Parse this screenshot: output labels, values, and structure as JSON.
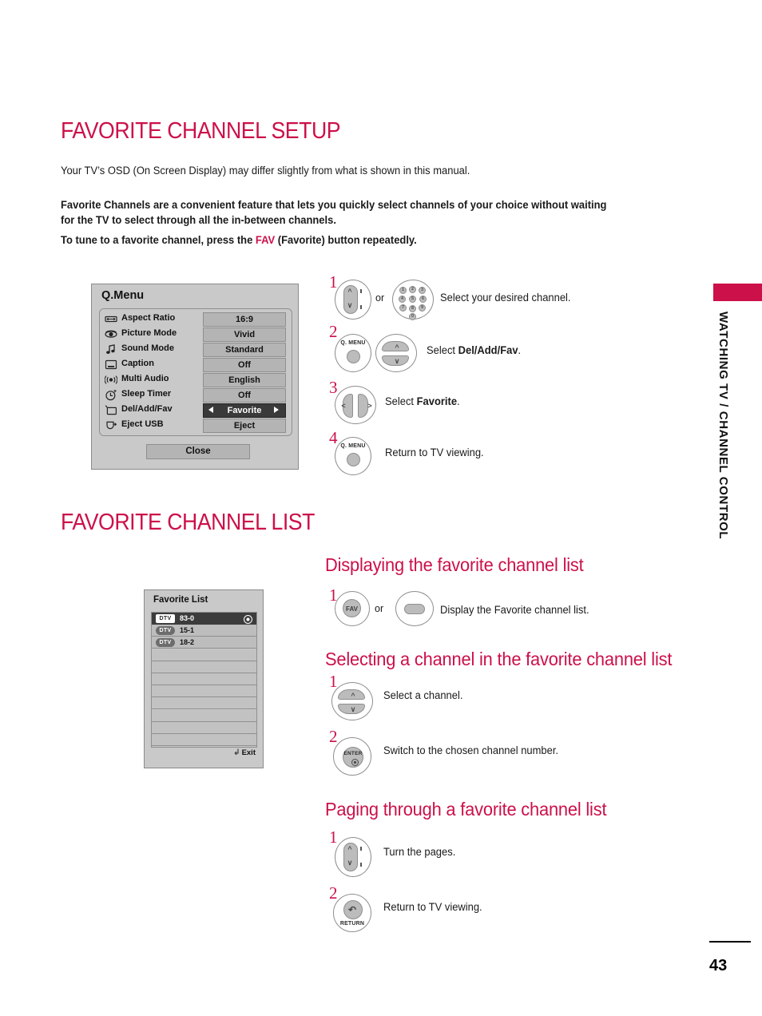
{
  "document": {
    "page_number": "43",
    "chapter_tab": "WATCHING TV / CHANNEL CONTROL"
  },
  "section_setup": {
    "title": "FAVORITE CHANNEL SETUP",
    "note": "Your TV’s OSD (On Screen Display) may differ slightly from what is shown in this manual.",
    "intro_line1": "Favorite Channels are a convenient feature that lets you quickly select channels of your choice without waiting",
    "intro_line2": "for the TV to select through all the in-between channels.",
    "intro_line3_pre": "To tune to a favorite channel, press the ",
    "intro_line3_key": "FAV",
    "intro_line3_post": " (Favorite) button repeatedly."
  },
  "qmenu": {
    "title": "Q.Menu",
    "close_label": "Close",
    "rows": [
      {
        "icon": "aspect-ratio-icon",
        "label": "Aspect Ratio",
        "value": "16:9",
        "selected": false
      },
      {
        "icon": "picture-mode-icon",
        "label": "Picture Mode",
        "value": "Vivid",
        "selected": false
      },
      {
        "icon": "sound-mode-icon",
        "label": "Sound Mode",
        "value": "Standard",
        "selected": false
      },
      {
        "icon": "caption-icon",
        "label": "Caption",
        "value": "Off",
        "selected": false
      },
      {
        "icon": "multi-audio-icon",
        "label": "Multi Audio",
        "value": "English",
        "selected": false
      },
      {
        "icon": "sleep-timer-icon",
        "label": "Sleep Timer",
        "value": "Off",
        "selected": false
      },
      {
        "icon": "del-add-fav-icon",
        "label": "Del/Add/Fav",
        "value": "Favorite",
        "selected": true
      },
      {
        "icon": "eject-usb-icon",
        "label": "Eject USB",
        "value": "Eject",
        "selected": false
      }
    ]
  },
  "setup_steps": [
    {
      "num": "1",
      "or_label": "or",
      "text_html": "Select your desired channel.",
      "keys": [
        "channel-rocker-key",
        "numeric-keypad-key"
      ]
    },
    {
      "num": "2",
      "text_html": "Select <b>Del/Add/Fav</b>.",
      "keys": [
        "q-menu-key",
        "up-down-arc-key"
      ]
    },
    {
      "num": "3",
      "text_html": "Select <b>Favorite</b>.",
      "keys": [
        "left-right-arc-key"
      ]
    },
    {
      "num": "4",
      "text_html": "Return to TV viewing.",
      "keys": [
        "q-menu-key"
      ]
    }
  ],
  "section_list": {
    "title": "FAVORITE CHANNEL LIST"
  },
  "favorite_list": {
    "title": "Favorite List",
    "exit_label": "Exit",
    "rows": [
      {
        "badge": "DTV",
        "number": "83-0",
        "active": true,
        "marked": true
      },
      {
        "badge": "DTV",
        "number": "15-1",
        "active": false,
        "marked": false
      },
      {
        "badge": "DTV",
        "number": "18-2",
        "active": false,
        "marked": false
      },
      {
        "badge": "",
        "number": "",
        "active": false,
        "marked": false
      },
      {
        "badge": "",
        "number": "",
        "active": false,
        "marked": false
      },
      {
        "badge": "",
        "number": "",
        "active": false,
        "marked": false
      },
      {
        "badge": "",
        "number": "",
        "active": false,
        "marked": false
      },
      {
        "badge": "",
        "number": "",
        "active": false,
        "marked": false
      },
      {
        "badge": "",
        "number": "",
        "active": false,
        "marked": false
      },
      {
        "badge": "",
        "number": "",
        "active": false,
        "marked": false
      },
      {
        "badge": "",
        "number": "",
        "active": false,
        "marked": false
      }
    ]
  },
  "subsection_displaying": {
    "heading": "Displaying the favorite channel list",
    "steps": [
      {
        "num": "1",
        "or_label": "or",
        "text": "Display the Favorite channel list.",
        "keys": [
          "fav-key",
          "oval-key"
        ]
      }
    ]
  },
  "subsection_selecting": {
    "heading": "Selecting a channel in the favorite channel list",
    "steps": [
      {
        "num": "1",
        "text": "Select a channel.",
        "keys": [
          "up-down-arc-key"
        ]
      },
      {
        "num": "2",
        "text": "Switch to the chosen channel number.",
        "keys": [
          "enter-key"
        ]
      }
    ]
  },
  "subsection_paging": {
    "heading": "Paging through a favorite channel list",
    "steps": [
      {
        "num": "1",
        "text": "Turn the pages.",
        "keys": [
          "channel-rocker-key"
        ]
      },
      {
        "num": "2",
        "text": "Return to TV viewing.",
        "keys": [
          "return-key"
        ]
      }
    ]
  },
  "key_labels": {
    "q_menu": "Q. MENU",
    "fav": "FAV",
    "enter": "ENTER",
    "return": "RETURN",
    "keypad_digits": [
      "1",
      "2",
      "3",
      "4",
      "5",
      "6",
      "7",
      "8",
      "9",
      "0"
    ]
  },
  "colors": {
    "accent": "#CC1049",
    "osd_background": "#c9c9c9",
    "osd_selected": "#3a3a3a"
  }
}
